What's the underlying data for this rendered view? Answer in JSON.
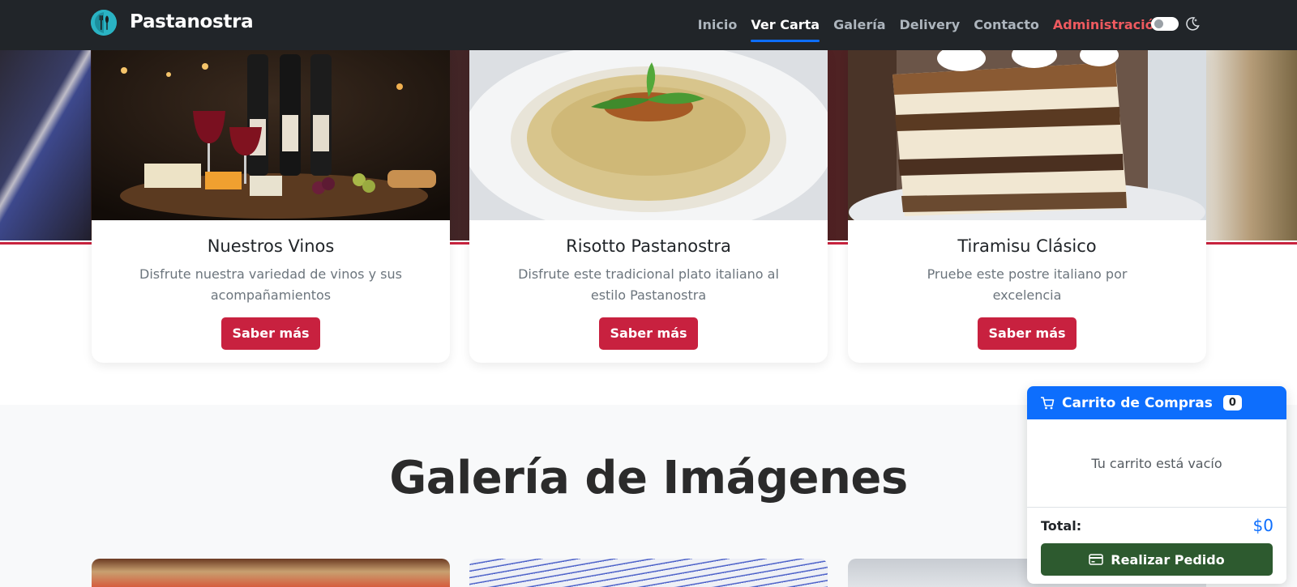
{
  "nav": {
    "brand": "Pastanostra",
    "links": [
      "Inicio",
      "Ver Carta",
      "Galería",
      "Delivery",
      "Contacto",
      "Administración"
    ],
    "active_link": "Ver Carta"
  },
  "cards": [
    {
      "title": "Nuestros Vinos",
      "description": "Disfrute nuestra variedad de vinos y sus acompañamientos",
      "button": "Saber más"
    },
    {
      "title": "Risotto Pastanostra",
      "description": "Disfrute este tradicional plato italiano al estilo Pastanostra",
      "button": "Saber más"
    },
    {
      "title": "Tiramisu Clásico",
      "description": "Pruebe este postre italiano por excelencia",
      "button": "Saber más"
    }
  ],
  "gallery": {
    "title": "Galería de Imágenes"
  },
  "cart": {
    "title": "Carrito de Compras",
    "count": "0",
    "empty_message": "Tu carrito está vacío",
    "total_label": "Total:",
    "total_value": "$0",
    "order_button": "Realizar Pedido"
  },
  "colors": {
    "navbar": "#212529",
    "accent_blue": "#0d6efd",
    "accent_red": "#c8213f",
    "order_green": "#2d5a2f",
    "admin_link": "#ef5a5f"
  },
  "icons": [
    "logo-icon",
    "toggle-icon",
    "moon-icon",
    "cart-icon",
    "credit-card-icon"
  ]
}
